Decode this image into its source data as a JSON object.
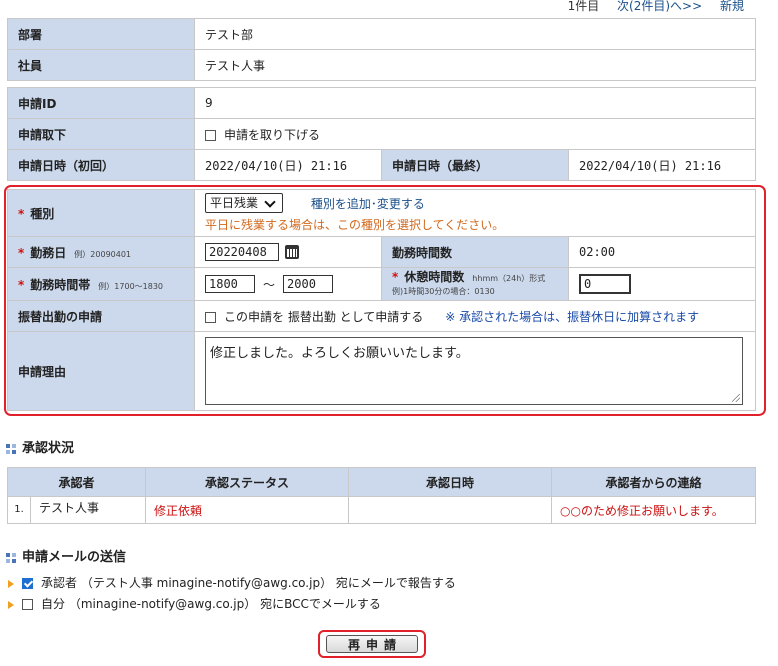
{
  "nav": {
    "count": "1件目",
    "next": "次(2件目)へ>>",
    "new": "新規"
  },
  "dept": {
    "label": "部署",
    "value": "テスト部"
  },
  "employee": {
    "label": "社員",
    "value": "テスト人事"
  },
  "app_id": {
    "label": "申請ID",
    "value": "9"
  },
  "withdraw": {
    "label": "申請取下",
    "checkbox_label": "申請を取り下げる",
    "checked": false
  },
  "app_date_first": {
    "label": "申請日時（初回）",
    "value": "2022/04/10(日) 21:16"
  },
  "app_date_last": {
    "label": "申請日時（最終）",
    "value": "2022/04/10(日) 21:16"
  },
  "type": {
    "label": "種別",
    "selected": "平日残業",
    "link": "種別を追加･変更する",
    "note": "平日に残業する場合は、この種別を選択してください。"
  },
  "work_date": {
    "label": "勤務日",
    "hint": "例）20090401",
    "value": "20220408"
  },
  "work_hours": {
    "label": "勤務時間数",
    "value": "02:00"
  },
  "work_period": {
    "label": "勤務時間帯",
    "hint": "例）1700～1830",
    "from": "1800",
    "tilde": "～",
    "to": "2000"
  },
  "break_hours": {
    "label": "休憩時間数",
    "hint1": "hhmm（24h）形式",
    "hint2": "例)1時間30分の場合：0130",
    "value": "0"
  },
  "substitute": {
    "label": "振替出勤の申請",
    "checkbox_label": "この申請を 振替出勤 として申請する",
    "note": "※ 承認された場合は、振替休日に加算されます",
    "checked": false
  },
  "reason": {
    "label": "申請理由",
    "value": "修正しました。よろしくお願いいたします。"
  },
  "approval": {
    "title": "承認状況",
    "headers": [
      "承認者",
      "承認ステータス",
      "承認日時",
      "承認者からの連絡"
    ],
    "rows": [
      {
        "no": "1.",
        "approver": "テスト人事",
        "status": "修正依頼",
        "date": "",
        "message": "○○のため修正お願いします。"
      }
    ]
  },
  "mail": {
    "title": "申請メールの送信",
    "option1": {
      "label": "承認者 （テスト人事 minagine-notify@awg.co.jp） 宛にメールで報告する",
      "checked": true
    },
    "option2": {
      "label": "自分 （minagine-notify@awg.co.jp） 宛にBCCでメールする",
      "checked": false
    }
  },
  "submit": {
    "label": "再申請"
  },
  "colors": {
    "label_bg": "#ccd9ec",
    "highlight_red": "#e0202a",
    "note_orange": "#d2691e",
    "link_blue": "#1a4f8a"
  }
}
